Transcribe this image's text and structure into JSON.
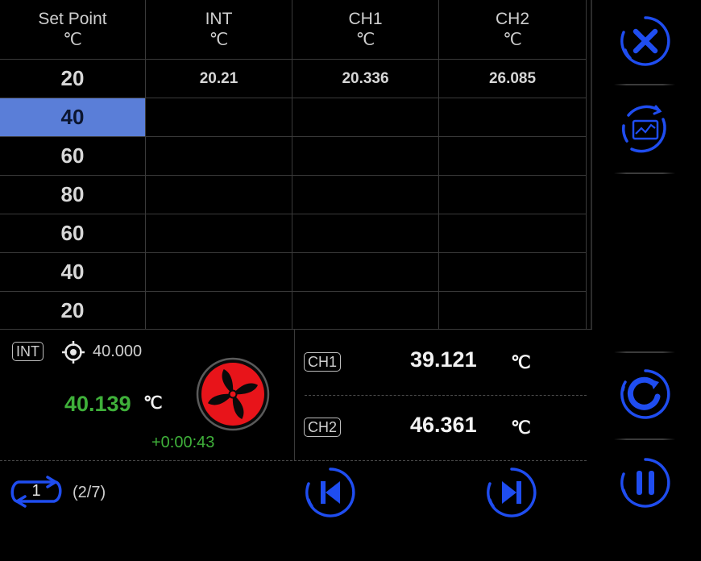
{
  "table": {
    "headers": [
      {
        "name": "Set Point",
        "unit": "℃"
      },
      {
        "name": "INT",
        "unit": "℃"
      },
      {
        "name": "CH1",
        "unit": "℃"
      },
      {
        "name": "CH2",
        "unit": "℃"
      }
    ],
    "setpoints": [
      "20",
      "40",
      "60",
      "80",
      "60",
      "40",
      "20"
    ],
    "selected_row": 1,
    "row1_values": [
      "20.21",
      "20.336",
      "26.085"
    ]
  },
  "int_panel": {
    "badge": "INT",
    "target": "40.000",
    "current": "40.139",
    "unit": "℃",
    "elapsed": "+0:00:43"
  },
  "channels": [
    {
      "badge": "CH1",
      "value": "39.121",
      "unit": "℃"
    },
    {
      "badge": "CH2",
      "value": "46.361",
      "unit": "℃"
    }
  ],
  "footer": {
    "loop_count": "1",
    "step": "(2/7)"
  },
  "colors": {
    "accent_blue": "#1f4df0",
    "selected_row": "#5a7ed8",
    "current_green": "#3fb03a",
    "fan_red": "#e8141a"
  },
  "icons": {
    "close": "close-icon",
    "chart": "chart-refresh-icon",
    "refresh": "refresh-icon",
    "pause": "pause-icon",
    "prev": "skip-previous-icon",
    "next": "skip-next-icon",
    "fan": "fan-icon",
    "target": "crosshair-icon",
    "loop": "loop-icon"
  }
}
